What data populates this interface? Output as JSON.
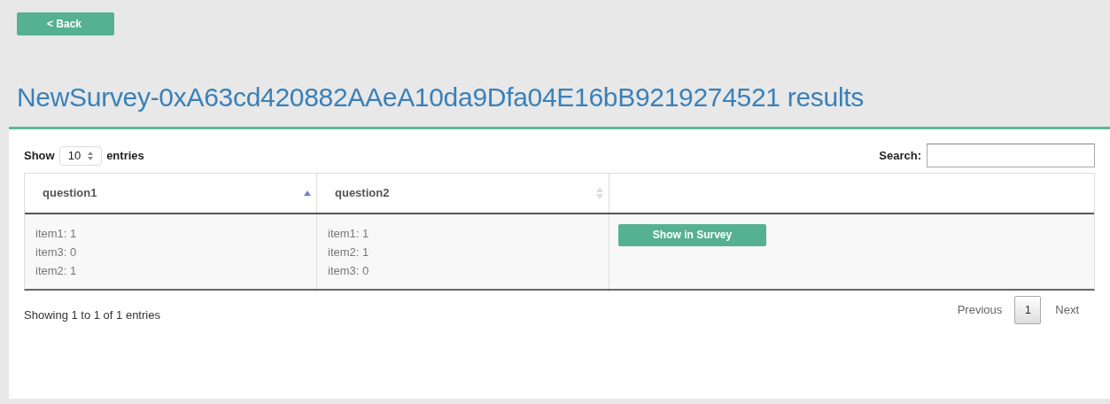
{
  "back_button": "< Back",
  "title": "NewSurvey-0xA63cd420882AAeA10da9Dfa04E16bB9219274521 results",
  "length_control": {
    "before": "Show",
    "value": "10",
    "after": "entries"
  },
  "search": {
    "label": "Search:"
  },
  "table": {
    "columns": [
      {
        "label": "question1",
        "sortable": true,
        "sorted": true
      },
      {
        "label": "question2",
        "sortable": true,
        "sorted": false
      }
    ],
    "rows": [
      {
        "cells": [
          [
            "item1: 1",
            "item3: 0",
            "item2: 1"
          ],
          [
            "item1: 1",
            "item2: 1",
            "item3: 0"
          ]
        ],
        "action": "Show in Survey"
      }
    ]
  },
  "info": "Showing 1 to 1 of 1 entries",
  "pagination": {
    "previous": "Previous",
    "pages": [
      {
        "label": "1",
        "selected": true
      }
    ],
    "next": "Next"
  }
}
